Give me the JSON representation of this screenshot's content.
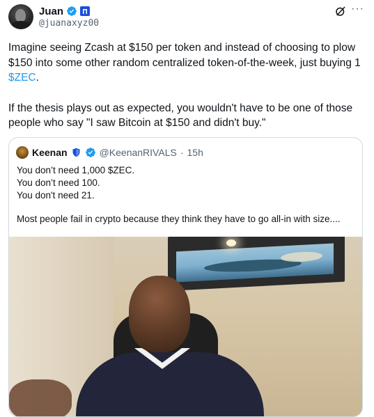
{
  "tweet": {
    "author_name": "Juan",
    "handle": "@juanaxyz00",
    "paragraphs": [
      {
        "before": "Imagine seeing Zcash at $150 per token and instead of choosing to plow $150 into some other random centralized token-of-the-week, just buying 1 ",
        "cashtag": "$ZEC",
        "after": "."
      },
      {
        "text": "If the thesis plays out as expected, you wouldn't have to be one of those people who say \"I saw Bitcoin at $150 and didn't buy.\""
      }
    ]
  },
  "quote": {
    "author_name": "Keenan",
    "handle": "@KeenanRIVALS",
    "separator": "·",
    "time": "15h",
    "lines": [
      "You don’t need 1,000 $ZEC.",
      "You don’t need 100.",
      "You don't need 21."
    ],
    "last_line": "Most people fail in crypto because they think they have to go all-in with size...."
  },
  "icons": {
    "verified": "verified-badge-icon",
    "grok": "grok-icon",
    "more": "more-icon",
    "shield": "shield-icon"
  },
  "colors": {
    "verified": "#1d9bf0",
    "cashtag": "#1d9bf0",
    "secondary_text": "#536471",
    "border": "#cfd9de"
  }
}
